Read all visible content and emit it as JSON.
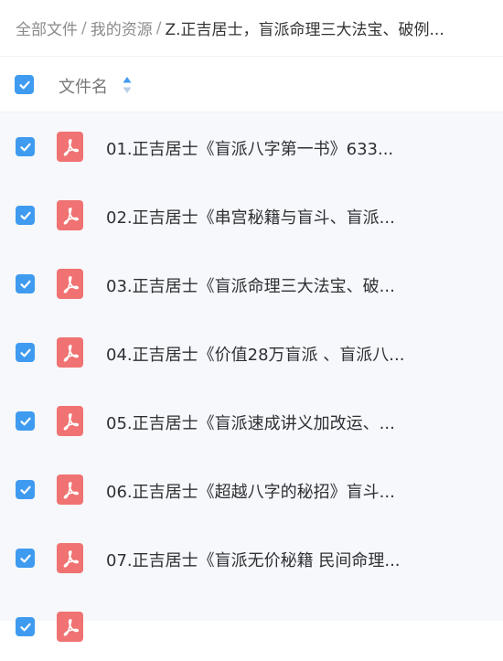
{
  "breadcrumb": {
    "root": "全部文件",
    "parent": "我的资源",
    "current": "Z.正吉居士，盲派命理三大法宝、破例..."
  },
  "header": {
    "column_label": "文件名",
    "select_all_checked": true
  },
  "files": [
    {
      "name": "01.正吉居士《盲派八字第一书》633...",
      "checked": true,
      "icon": "pdf-icon"
    },
    {
      "name": "02.正吉居士《串宫秘籍与盲斗、盲派...",
      "checked": true,
      "icon": "pdf-icon"
    },
    {
      "name": "03.正吉居士《盲派命理三大法宝、破...",
      "checked": true,
      "icon": "pdf-icon"
    },
    {
      "name": "04.正吉居士《价值28万盲派 、盲派八...",
      "checked": true,
      "icon": "pdf-icon"
    },
    {
      "name": "05.正吉居士《盲派速成讲义加改运、...",
      "checked": true,
      "icon": "pdf-icon"
    },
    {
      "name": "06.正吉居士《超越八字的秘招》盲斗...",
      "checked": true,
      "icon": "pdf-icon"
    },
    {
      "name": "07.正吉居士《盲派无价秘籍 民间命理...",
      "checked": true,
      "icon": "pdf-icon"
    },
    {
      "name": "",
      "checked": true,
      "icon": "pdf-icon"
    }
  ],
  "colors": {
    "accent": "#3f9bf0",
    "pdf": "#f07272"
  }
}
